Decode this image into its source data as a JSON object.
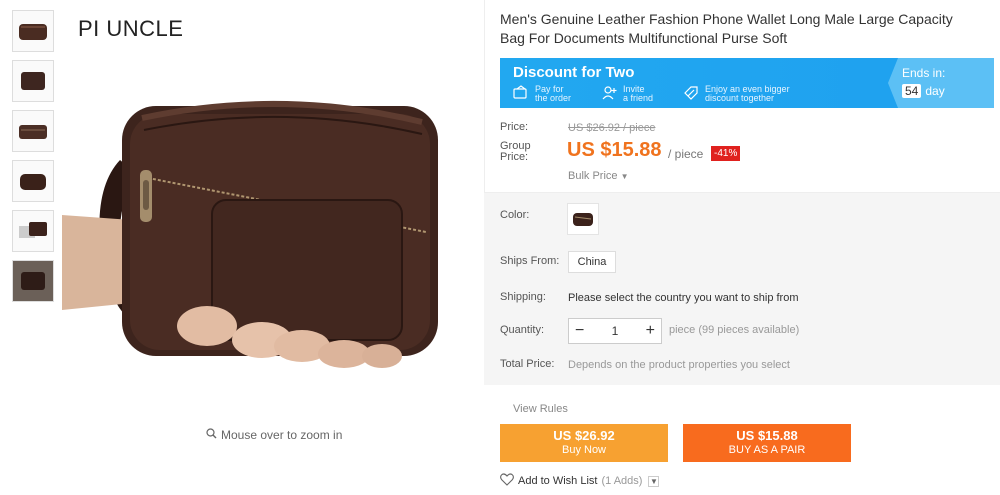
{
  "brand": "PI UNCLE",
  "zoom_hint": "Mouse over to zoom in",
  "title": "Men's Genuine Leather Fashion Phone Wallet Long Male Large Capacity Bag For Documents Multifunctional Purse Soft",
  "discount": {
    "heading": "Discount for Two",
    "steps": [
      {
        "line1": "Pay for",
        "line2": "the order"
      },
      {
        "line1": "Invite",
        "line2": "a friend"
      },
      {
        "line1": "Enjoy an even bigger",
        "line2": "discount together"
      }
    ],
    "ends_label": "Ends in:",
    "ends_days": "54",
    "ends_unit": "day"
  },
  "price": {
    "price_label": "Price:",
    "old": "US $26.92 / piece",
    "group_label_1": "Group",
    "group_label_2": "Price:",
    "current": "US $15.88",
    "per": "/ piece",
    "off": "-41%",
    "bulk": "Bulk Price"
  },
  "options": {
    "color_label": "Color:",
    "ships_from_label": "Ships From:",
    "ships_from_value": "China",
    "shipping_label": "Shipping:",
    "shipping_text": "Please select the country you want to ship from",
    "quantity_label": "Quantity:",
    "quantity_value": "1",
    "quantity_minus": "−",
    "quantity_plus": "+",
    "quantity_note": "piece (99 pieces available)",
    "total_label": "Total Price:",
    "total_text": "Depends on the product properties you select"
  },
  "actions": {
    "view_rules": "View Rules",
    "buy_price": "US $26.92",
    "buy_label": "Buy Now",
    "pair_price": "US $15.88",
    "pair_label": "BUY AS A PAIR",
    "wish_label": "Add to Wish List",
    "wish_count": "(1 Adds)"
  },
  "colors": {
    "discount_blue": "#22a8f0",
    "price_orange": "#f0731e",
    "off_red": "#e0211e",
    "buy_now": "#f7a131",
    "buy_pair": "#f86b1e"
  }
}
